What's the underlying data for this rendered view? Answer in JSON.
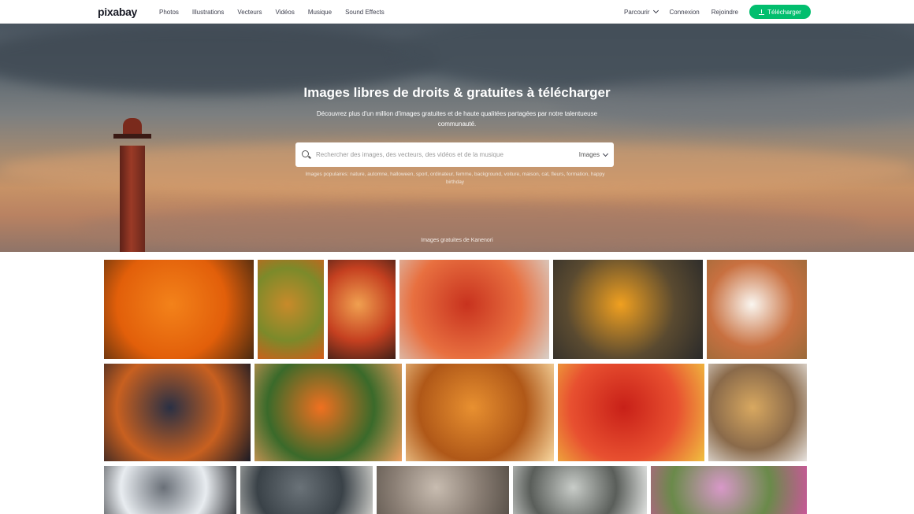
{
  "nav": {
    "logo": "pixabay",
    "links": [
      "Photos",
      "Illustrations",
      "Vecteurs",
      "Vidéos",
      "Musique",
      "Sound Effects"
    ],
    "explore_label": "Parcourir",
    "login_label": "Connexion",
    "join_label": "Rejoindre",
    "download_label": "Télécharger"
  },
  "hero": {
    "title": "Images libres de droits & gratuites à télécharger",
    "subtitle": "Découvrez plus d'un million d'images gratuites et de haute qualitées partagées par notre talentueuse communauté.",
    "search_placeholder": "Rechercher des images, des vecteurs, des vidéos et de la musique",
    "search_type": "Images",
    "popular": "Images populaires: nature, automne, halloween, sport, ordinateur, femme, background, voiture, maison, cat, fleurs, formation, happy birthday",
    "credit": "Images gratuites de Kanenori"
  },
  "colors": {
    "accent": "#02be6e",
    "text_dark": "#191b26"
  },
  "gallery": [
    {
      "name": "orange-poppy-image",
      "colors": [
        "#f3821a",
        "#e25f0a",
        "#4a2a10"
      ]
    },
    {
      "name": "autumn-leaf-image",
      "colors": [
        "#c88a2a",
        "#7c8a2a",
        "#d35c1a"
      ]
    },
    {
      "name": "orange-sunset-image",
      "colors": [
        "#f0a050",
        "#c54020",
        "#402018"
      ]
    },
    {
      "name": "red-maple-leaves-image",
      "colors": [
        "#c8321e",
        "#e87040",
        "#d8d0c8"
      ]
    },
    {
      "name": "pagoda-sunset-image",
      "colors": [
        "#f0a020",
        "#5a4a30",
        "#2a2a2a"
      ]
    },
    {
      "name": "autumn-pattern-image",
      "colors": [
        "#faf6f0",
        "#c87040",
        "#9a6a3a"
      ]
    },
    {
      "name": "cargo-ship-night-image",
      "colors": [
        "#2a3044",
        "#c86020",
        "#1a1a24"
      ]
    },
    {
      "name": "orange-lily-image",
      "colors": [
        "#f07020",
        "#3a6a2a",
        "#f0a060"
      ]
    },
    {
      "name": "citrine-crystal-image",
      "colors": [
        "#e89030",
        "#b05818",
        "#f8d8a0"
      ]
    },
    {
      "name": "red-flower-macro-image",
      "colors": [
        "#c82018",
        "#e85030",
        "#f0c040"
      ]
    },
    {
      "name": "forest-rabbit-illustration",
      "colors": [
        "#d8a860",
        "#8a6a4a",
        "#e8e4e0"
      ]
    },
    {
      "name": "snowy-mountain-image",
      "colors": [
        "#6a7078",
        "#e8ecf0",
        "#3a3c40"
      ]
    },
    {
      "name": "otter-water-image",
      "colors": [
        "#6a7278",
        "#3a4248",
        "#c8c8c4"
      ]
    },
    {
      "name": "old-coins-image",
      "colors": [
        "#c8bcb0",
        "#8a7e74",
        "#5a524a"
      ]
    },
    {
      "name": "misty-forest-image",
      "colors": [
        "#c8ccc8",
        "#5a5e5a",
        "#e0e2e0"
      ]
    },
    {
      "name": "pink-flowers-image",
      "colors": [
        "#d898c8",
        "#6a8a4a",
        "#c85898"
      ]
    }
  ]
}
